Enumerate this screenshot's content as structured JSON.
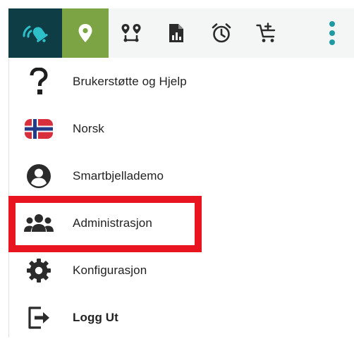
{
  "colors": {
    "brand_bg": "#0e3d46",
    "brand_icon": "#2ec0c9",
    "location_bg": "#7da444",
    "toolbar_bg": "#f4f5f5",
    "icon_dark": "#2b2b2b",
    "teal_dots": "#1f9aa3",
    "highlight": "#e8141f"
  },
  "toolbar": {
    "icons": [
      "bell-logo-icon",
      "location-pin-icon",
      "route-icon",
      "report-icon",
      "alarm-clock-icon",
      "cart-add-icon",
      "more-vertical-icon"
    ]
  },
  "menu": {
    "items": [
      {
        "label": "Brukerstøtte og Hjelp",
        "icon": "question-icon"
      },
      {
        "label": "Norsk",
        "icon": "norway-flag-icon"
      },
      {
        "label": "Smartbjellademo",
        "icon": "account-icon"
      },
      {
        "label": "Administrasjon",
        "icon": "group-icon",
        "highlighted": true
      },
      {
        "label": "Konfigurasjon",
        "icon": "gear-icon"
      },
      {
        "label": "Logg Ut",
        "icon": "logout-icon"
      }
    ]
  }
}
